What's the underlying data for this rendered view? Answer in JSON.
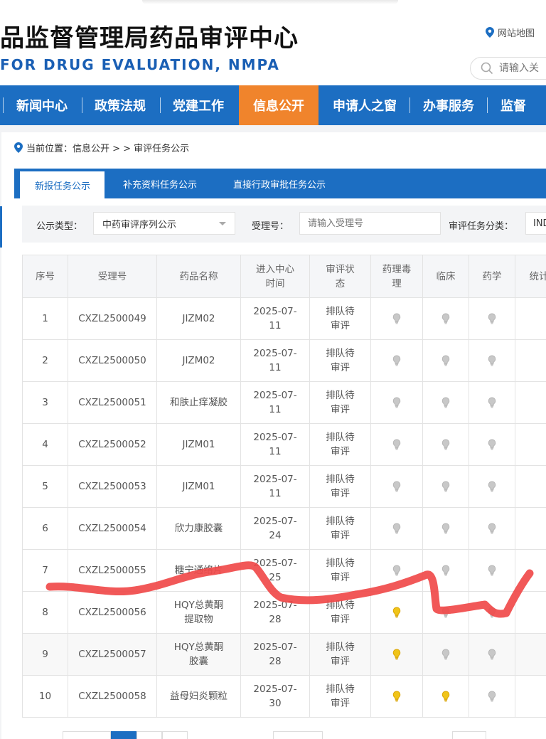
{
  "header": {
    "title_cn": "品监督管理局药品审评中心",
    "title_en": "FOR DRUG EVALUATION, NMPA",
    "sitemap_label": "网站地图",
    "search_placeholder": "请输入关"
  },
  "nav": {
    "items": [
      {
        "label": "新闻中心"
      },
      {
        "label": "政策法规"
      },
      {
        "label": "党建工作"
      },
      {
        "label": "信息公开",
        "active": true
      },
      {
        "label": "申请人之窗"
      },
      {
        "label": "办事服务"
      },
      {
        "label": "监督"
      }
    ]
  },
  "breadcrumb": {
    "text": "当前位置：信息公开 > > 审评任务公示"
  },
  "tabs": [
    {
      "label": "新报任务公示",
      "active": true
    },
    {
      "label": "补充资料任务公示"
    },
    {
      "label": "直接行政审批任务公示"
    }
  ],
  "filter": {
    "type_label": "公示类型：",
    "type_value": "中药审评序列公示",
    "accept_label": "受理号：",
    "accept_placeholder": "请输入受理号",
    "class_label": "审评任务分类：",
    "class_value": "IND"
  },
  "table": {
    "headers": [
      "序号",
      "受理号",
      "药品名称",
      "进入中心时间",
      "审评状态",
      "药理毒理",
      "临床",
      "药学",
      "统计"
    ],
    "header_lines": {
      "time_1": "进入中心",
      "time_2": "时间",
      "status_1": "审评状",
      "status_2": "态",
      "pharm_1": "药理毒",
      "pharm_2": "理"
    },
    "rows": [
      {
        "no": "1",
        "accept": "CXZL2500049",
        "name1": "JIZM02",
        "name2": "",
        "date1": "2025-07-",
        "date2": "11",
        "status1": "排队待",
        "status2": "审评",
        "pharm": false,
        "clin": false,
        "chem": false
      },
      {
        "no": "2",
        "accept": "CXZL2500050",
        "name1": "JIZM02",
        "name2": "",
        "date1": "2025-07-",
        "date2": "11",
        "status1": "排队待",
        "status2": "审评",
        "pharm": false,
        "clin": false,
        "chem": false
      },
      {
        "no": "3",
        "accept": "CXZL2500051",
        "name1": "和肤止痒凝胶",
        "name2": "",
        "date1": "2025-07-",
        "date2": "11",
        "status1": "排队待",
        "status2": "审评",
        "pharm": false,
        "clin": false,
        "chem": false
      },
      {
        "no": "4",
        "accept": "CXZL2500052",
        "name1": "JIZM01",
        "name2": "",
        "date1": "2025-07-",
        "date2": "11",
        "status1": "排队待",
        "status2": "审评",
        "pharm": false,
        "clin": false,
        "chem": false
      },
      {
        "no": "5",
        "accept": "CXZL2500053",
        "name1": "JIZM01",
        "name2": "",
        "date1": "2025-07-",
        "date2": "11",
        "status1": "排队待",
        "status2": "审评",
        "pharm": false,
        "clin": false,
        "chem": false
      },
      {
        "no": "6",
        "accept": "CXZL2500054",
        "name1": "欣力康胶囊",
        "name2": "",
        "date1": "2025-07-",
        "date2": "24",
        "status1": "排队待",
        "status2": "审评",
        "pharm": false,
        "clin": false,
        "chem": false
      },
      {
        "no": "7",
        "accept": "CXZL2500055",
        "name1": "糖宁通络片",
        "name2": "",
        "date1": "2025-07-",
        "date2": "25",
        "status1": "排队待",
        "status2": "审评",
        "pharm": false,
        "clin": false,
        "chem": false
      },
      {
        "no": "8",
        "accept": "CXZL2500056",
        "name1": "HQY总黄酮",
        "name2": "提取物",
        "date1": "2025-07-",
        "date2": "28",
        "status1": "排队待",
        "status2": "审评",
        "pharm": true,
        "clin": false,
        "chem": false
      },
      {
        "no": "9",
        "accept": "CXZL2500057",
        "name1": "HQY总黄酮",
        "name2": "胶囊",
        "date1": "2025-07-",
        "date2": "28",
        "status1": "排队待",
        "status2": "审评",
        "pharm": true,
        "clin": false,
        "chem": false
      },
      {
        "no": "10",
        "accept": "CXZL2500058",
        "name1": "益母妇炎颗粒",
        "name2": "",
        "date1": "2025-07-",
        "date2": "30",
        "status1": "排队待",
        "status2": "审评",
        "pharm": true,
        "clin": true,
        "chem": false
      }
    ]
  },
  "colors": {
    "nav_blue": "#1c6ec2",
    "nav_active": "#f0842c",
    "bulb_on": "#f0c419",
    "bulb_off": "#c8c8c8",
    "scribble": "#f04a4a"
  },
  "icons": {
    "location": "location-pin-icon",
    "search": "search-icon",
    "bulb": "lightbulb-icon"
  }
}
